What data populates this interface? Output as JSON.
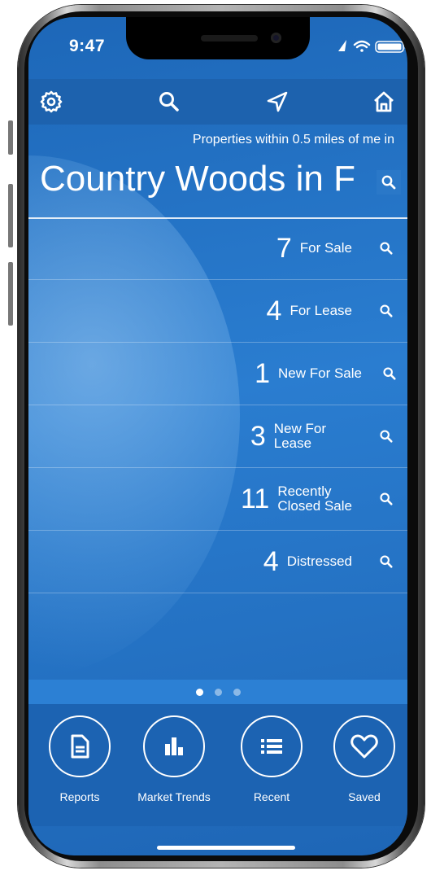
{
  "status": {
    "time": "9:47"
  },
  "nav": {
    "settings_icon": "gear-icon",
    "search_icon": "search-icon",
    "location_icon": "location-arrow-icon",
    "home_icon": "home-icon"
  },
  "header": {
    "subtitle": "Properties within 0.5 miles of me in",
    "title": "Country Woods in F"
  },
  "stats": [
    {
      "count": "7",
      "label": "For Sale"
    },
    {
      "count": "4",
      "label": "For Lease"
    },
    {
      "count": "1",
      "label": "New For Sale"
    },
    {
      "count": "3",
      "label_line1": "New For",
      "label_line2": "Lease"
    },
    {
      "count": "11",
      "label_line1": "Recently",
      "label_line2": "Closed Sale"
    },
    {
      "count": "4",
      "label": "Distressed"
    }
  ],
  "pager": {
    "pages": 3,
    "active": 1
  },
  "tabs": [
    {
      "label": "Reports",
      "icon": "document-icon"
    },
    {
      "label": "Market Trends",
      "icon": "bar-chart-icon"
    },
    {
      "label": "Recent",
      "icon": "list-icon"
    },
    {
      "label": "Saved",
      "icon": "heart-icon"
    }
  ],
  "colors": {
    "primary": "#1d62ae",
    "accent": "#2c80d4",
    "text": "#ffffff"
  }
}
